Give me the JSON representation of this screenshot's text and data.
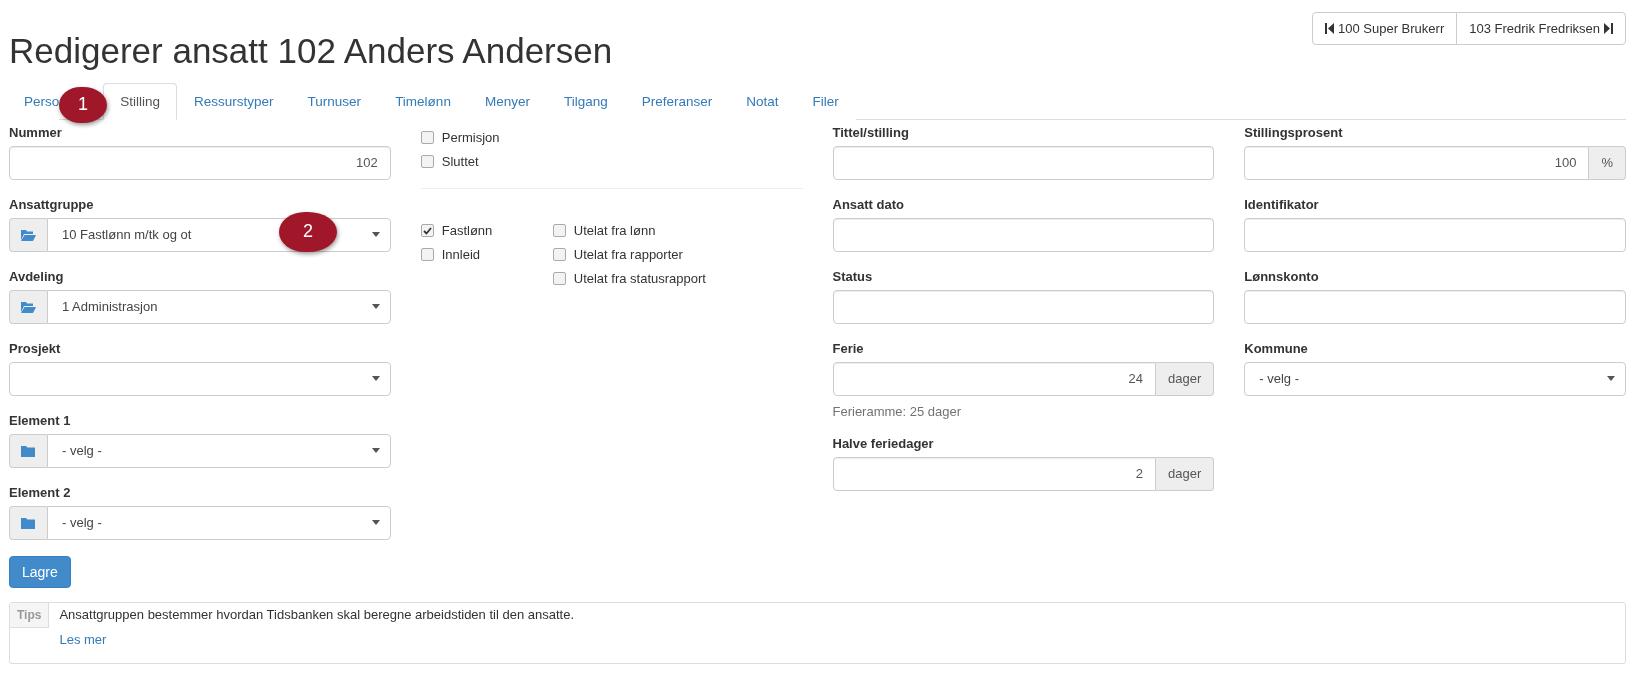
{
  "title": "Redigerer ansatt 102 Anders Andersen",
  "nav_buttons": [
    {
      "label": "100 Super Brukerr",
      "kind": "prev"
    },
    {
      "label": "103 Fredrik Fredriksen",
      "kind": "next"
    }
  ],
  "tabs": [
    {
      "label": "Perso",
      "selected": false
    },
    {
      "label": "Stilling",
      "selected": true
    },
    {
      "label": "Ressurstyper",
      "selected": false
    },
    {
      "label": "Turnuser",
      "selected": false
    },
    {
      "label": "Timelønn",
      "selected": false
    },
    {
      "label": "Menyer",
      "selected": false
    },
    {
      "label": "Tilgang",
      "selected": false
    },
    {
      "label": "Preferanser",
      "selected": false
    },
    {
      "label": "Notat",
      "selected": false
    },
    {
      "label": "Filer",
      "selected": false
    }
  ],
  "callouts": [
    {
      "label": "1"
    },
    {
      "label": "2"
    }
  ],
  "column_1": [
    {
      "label": "Nummer",
      "kind": "text",
      "value": "102"
    },
    {
      "label": "Ansattgruppe",
      "kind": "picker",
      "value": "10 Fastlønn m/tk og ot"
    },
    {
      "label": "Avdeling",
      "kind": "picker",
      "value": "1 Administrasjon"
    },
    {
      "label": "Prosjekt",
      "kind": "select"
    },
    {
      "label": "Element 1",
      "kind": "lookup",
      "value": "- velg -"
    },
    {
      "label": "Element 2",
      "kind": "lookup",
      "value": "- velg -"
    }
  ],
  "status_checks": [
    {
      "label": "Permisjon",
      "checked": false
    },
    {
      "label": "Sluttet",
      "checked": false
    }
  ],
  "type_checks": [
    {
      "label": "Fastlønn",
      "checked": true
    },
    {
      "label": "Innleid",
      "checked": false
    }
  ],
  "exclude_checks": [
    {
      "label": "Utelat fra lønn",
      "checked": false
    },
    {
      "label": "Utelat fra rapporter",
      "checked": false
    },
    {
      "label": "Utelat fra statusrapport",
      "checked": false
    }
  ],
  "column_3": [
    {
      "label": "Tittel/stilling",
      "kind": "text"
    },
    {
      "label": "Ansatt dato",
      "kind": "text"
    },
    {
      "label": "Status",
      "kind": "text"
    },
    {
      "label": "Ferie",
      "kind": "text",
      "value": "24",
      "addon": "dager",
      "help": "Ferieramme: 25 dager"
    },
    {
      "label": "Halve feriedager",
      "kind": "text",
      "value": "2",
      "addon": "dager"
    }
  ],
  "column_4": [
    {
      "label": "Stillingsprosent",
      "kind": "text",
      "value": "100",
      "addon": "%"
    },
    {
      "label": "Identifikator",
      "kind": "text"
    },
    {
      "label": "Lønnskonto",
      "kind": "text"
    },
    {
      "label": "Kommune",
      "kind": "select",
      "value": "- velg -"
    }
  ],
  "save_button": "Lagre",
  "tips": {
    "badge": "Tips",
    "text": "Ansattgruppen bestemmer hvordan Tidsbanken skal beregne arbeidstiden til den ansatte.",
    "link": "Les mer"
  }
}
